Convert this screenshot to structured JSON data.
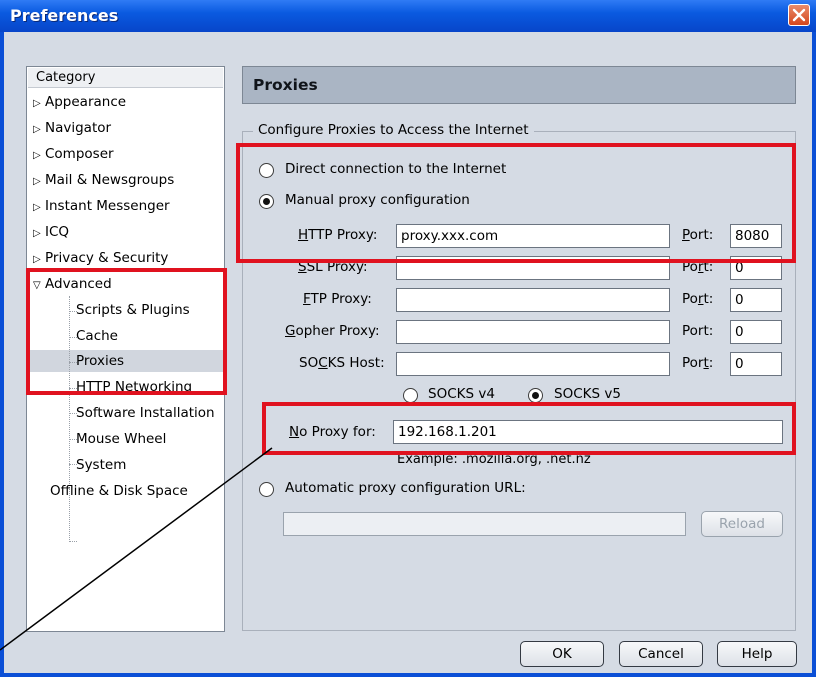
{
  "window": {
    "title": "Preferences"
  },
  "category": {
    "header": "Category",
    "items": [
      {
        "label": "Appearance",
        "expander": "▷"
      },
      {
        "label": "Navigator",
        "expander": "▷"
      },
      {
        "label": "Composer",
        "expander": "▷"
      },
      {
        "label": "Mail & Newsgroups",
        "expander": "▷"
      },
      {
        "label": "Instant Messenger",
        "expander": "▷"
      },
      {
        "label": "ICQ",
        "expander": "▷"
      },
      {
        "label": "Privacy & Security",
        "expander": "▷"
      },
      {
        "label": "Advanced",
        "expander": "▽"
      },
      {
        "label": "Scripts & Plugins"
      },
      {
        "label": "Cache"
      },
      {
        "label": "Proxies",
        "selected": true
      },
      {
        "label": "HTTP Networking"
      },
      {
        "label": "Software Installation"
      },
      {
        "label": "Mouse Wheel"
      },
      {
        "label": "System"
      },
      {
        "label": "Offline & Disk Space"
      }
    ]
  },
  "panel": {
    "title": "Proxies",
    "group_label": "Configure Proxies to Access the Internet",
    "direct": {
      "label": "Direct connection to the Internet",
      "checked": false
    },
    "manual": {
      "label": "Manual proxy configuration",
      "checked": true
    },
    "http": {
      "label_u": "H",
      "label_rest": "TTP Proxy:",
      "value": "proxy.xxx.com",
      "port_label_u": "P",
      "port_label_rest": "ort:",
      "port": "8080"
    },
    "ssl": {
      "label_u": "S",
      "label_rest": "SL Proxy:",
      "value": "",
      "port_label_pre": "Po",
      "port_label_u": "r",
      "port_label_rest": "t:",
      "port": "0"
    },
    "ftp": {
      "label_u": "F",
      "label_rest": "TP Proxy:",
      "value": "",
      "port_label_pre": "Po",
      "port_label_u": "r",
      "port_label_rest": "t:",
      "port": "0"
    },
    "gopher": {
      "label_u": "G",
      "label_rest": "opher Proxy:",
      "value": "",
      "port_label": "Port:",
      "port": "0"
    },
    "socks": {
      "label_pre": "SO",
      "label_u": "C",
      "label_rest": "KS Host:",
      "value": "",
      "port_label_pre": "Por",
      "port_label_u": "t",
      "port_label_rest": ":",
      "port": "0"
    },
    "socks_v4": {
      "label": "SOCKS v4",
      "checked": false
    },
    "socks_v5": {
      "label": "SOCKS v5",
      "checked": true
    },
    "no_proxy": {
      "label_u": "N",
      "label_rest": "o Proxy for:",
      "value": "192.168.1.201",
      "example": "Example: .mozilla.org, .net.nz"
    },
    "auto": {
      "label": "Automatic proxy configuration URL:",
      "checked": false,
      "value": ""
    },
    "reload_label": "Reload"
  },
  "buttons": {
    "ok": "OK",
    "cancel": "Cancel",
    "help": "Help"
  },
  "colors": {
    "annotation_red": "#e0121f",
    "titlebar_blue": "#0a5ae0"
  }
}
